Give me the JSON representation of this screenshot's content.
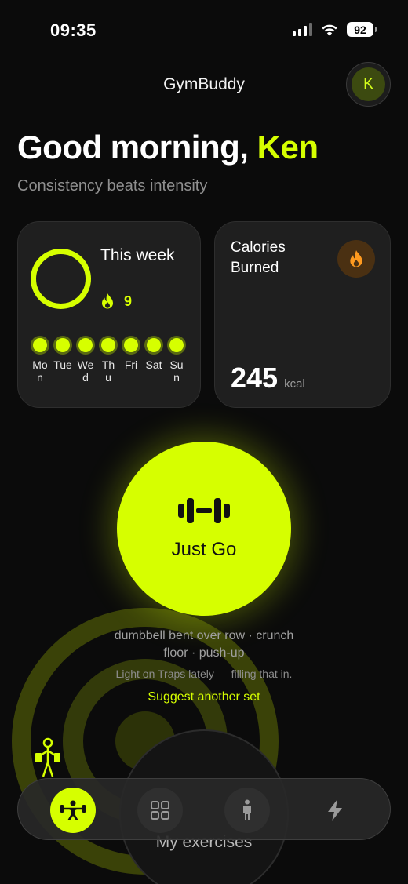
{
  "status": {
    "time": "09:35",
    "battery": "92"
  },
  "header": {
    "app_title": "GymBuddy",
    "avatar_initial": "K"
  },
  "greeting": {
    "prefix": "Good morning, ",
    "name": "Ken",
    "subtitle": "Consistency beats intensity"
  },
  "week_card": {
    "title": "This week",
    "streak": "9",
    "days": [
      "Mon",
      "Tue",
      "Wed",
      "Thu",
      "Fri",
      "Sat",
      "Sun"
    ]
  },
  "calories_card": {
    "title": "Calories Burned",
    "value": "245",
    "unit": "kcal"
  },
  "just_go": {
    "label": "Just Go"
  },
  "suggestion": {
    "exercises_line1": "dumbbell bent over row · crunch",
    "exercises_line2": "floor · push-up",
    "hint": "Light on Traps lately — filling that in.",
    "action": "Suggest another set"
  },
  "my_exercises": {
    "label": "My exercises"
  },
  "colors": {
    "accent": "#d6ff00",
    "background": "#0b0b0b",
    "card": "#1f1f1f",
    "fire": "#ff9a1f"
  },
  "nav": {
    "items": [
      {
        "icon": "weightlifter-icon",
        "active": true
      },
      {
        "icon": "grid-icon",
        "active": false
      },
      {
        "icon": "person-icon",
        "active": false
      },
      {
        "icon": "bolt-icon",
        "active": false
      }
    ]
  }
}
